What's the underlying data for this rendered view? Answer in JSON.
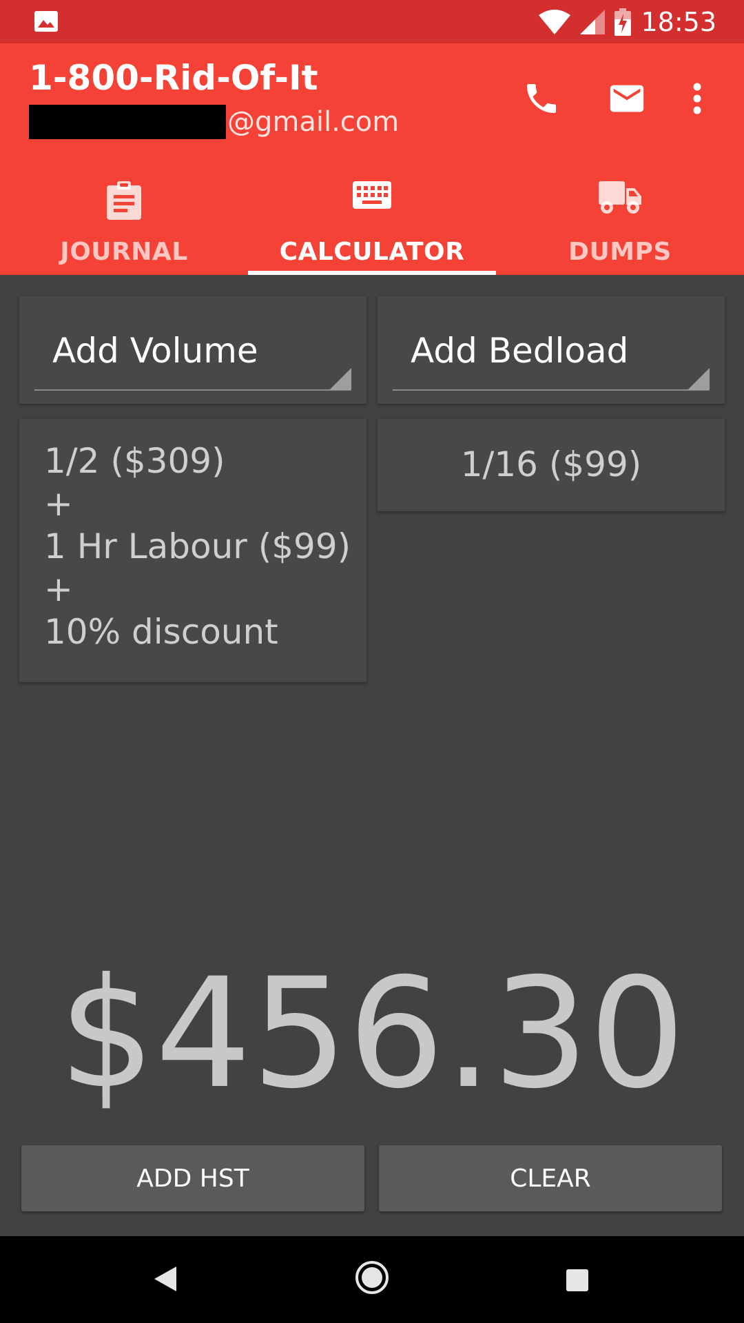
{
  "status_bar": {
    "time": "18:53"
  },
  "app": {
    "title": "1-800-Rid-Of-It",
    "email_suffix": "@gmail.com"
  },
  "tabs": [
    {
      "label": "JOURNAL",
      "icon": "clipboard-icon",
      "active": false
    },
    {
      "label": "CALCULATOR",
      "icon": "keyboard-icon",
      "active": true
    },
    {
      "label": "DUMPS",
      "icon": "truck-icon",
      "active": false
    }
  ],
  "spinners": {
    "volume": "Add Volume",
    "bedload": "Add Bedload"
  },
  "volume_card": {
    "lines": [
      "1/2 ($309)",
      "+",
      "1 Hr Labour ($99)",
      "+",
      "10% discount"
    ]
  },
  "bedload_card": {
    "text": "1/16 ($99)"
  },
  "total": "$456.30",
  "buttons": {
    "add_hst": "ADD HST",
    "clear": "CLEAR"
  },
  "colors": {
    "primary": "#f44336",
    "primary_dark": "#d32f2f",
    "background": "#424242",
    "card": "#484848",
    "button": "#5a5a5b"
  }
}
